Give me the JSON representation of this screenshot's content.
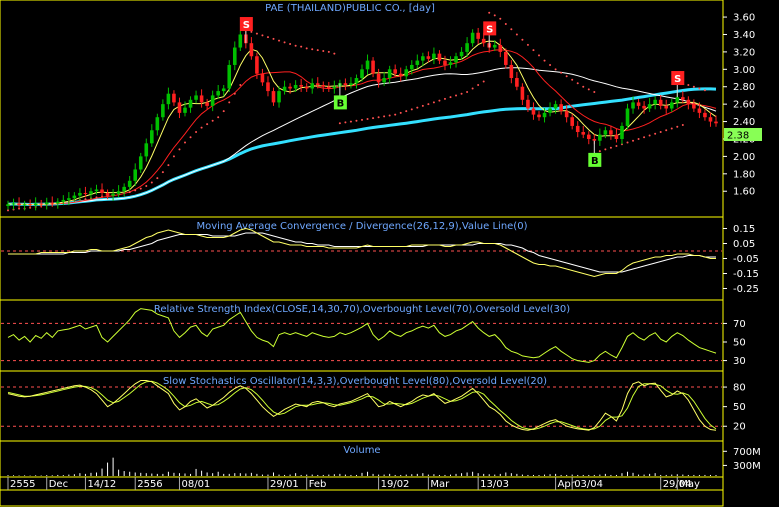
{
  "colors": {
    "background": "#000000",
    "panel_border": "#ffff00",
    "title_text": "#6fa8ff",
    "axis_text": "#ffffff",
    "candle_up": "#00c000",
    "candle_down": "#ff2020",
    "ma_short": "#ffff66",
    "ma_mid": "#ff2020",
    "ma_long": "#ffffff",
    "ma_longest": "#33e0ff",
    "sar": "#ff5050",
    "signal_buy": "#66ff33",
    "signal_sell": "#ff2020",
    "macd_line": "#ffff66",
    "macd_signal": "#ffffff",
    "rsi_line": "#ccff33",
    "ref_level": "#ff5050",
    "stoch_k": "#ffff66",
    "stoch_d": "#ccff33",
    "volume_bar": "#ffffff",
    "last_price_bg": "#88ff55"
  },
  "chart_data": [
    {
      "type": "candlestick",
      "title": "PAE (THAILAND)PUBLIC CO., [day]",
      "ylim": [
        1.35,
        3.75
      ],
      "y_ticks": [
        "3.60",
        "3.40",
        "3.20",
        "3.00",
        "2.80",
        "2.60",
        "2.40",
        "2.20",
        "2.00",
        "1.80",
        "1.60"
      ],
      "last_price": "2.38",
      "closes": [
        1.45,
        1.46,
        1.44,
        1.45,
        1.44,
        1.46,
        1.45,
        1.47,
        1.46,
        1.48,
        1.5,
        1.52,
        1.55,
        1.58,
        1.57,
        1.6,
        1.62,
        1.58,
        1.55,
        1.57,
        1.6,
        1.65,
        1.72,
        1.85,
        2.0,
        2.15,
        2.3,
        2.45,
        2.6,
        2.72,
        2.62,
        2.5,
        2.56,
        2.65,
        2.7,
        2.62,
        2.58,
        2.7,
        2.75,
        2.78,
        3.05,
        3.25,
        3.4,
        3.3,
        3.15,
        2.95,
        2.85,
        2.75,
        2.62,
        2.75,
        2.8,
        2.78,
        2.82,
        2.8,
        2.78,
        2.84,
        2.82,
        2.8,
        2.78,
        2.8,
        2.84,
        2.82,
        2.84,
        2.9,
        3.0,
        3.1,
        2.95,
        2.85,
        2.9,
        3.0,
        2.95,
        2.92,
        3.0,
        3.05,
        3.1,
        3.15,
        3.12,
        3.18,
        3.1,
        3.05,
        3.08,
        3.15,
        3.2,
        3.3,
        3.42,
        3.35,
        3.3,
        3.25,
        3.28,
        3.2,
        3.05,
        2.9,
        2.8,
        2.65,
        2.55,
        2.48,
        2.45,
        2.5,
        2.55,
        2.6,
        2.52,
        2.45,
        2.35,
        2.28,
        2.25,
        2.2,
        2.18,
        2.25,
        2.3,
        2.25,
        2.2,
        2.35,
        2.55,
        2.62,
        2.58,
        2.55,
        2.6,
        2.65,
        2.58,
        2.55,
        2.62,
        2.68,
        2.65,
        2.6,
        2.55,
        2.5,
        2.45,
        2.4,
        2.38
      ],
      "sar": [
        1.38,
        1.39,
        1.4,
        1.4,
        1.41,
        1.42,
        1.43,
        1.44,
        1.45,
        1.46,
        1.47,
        1.48,
        1.49,
        1.5,
        1.51,
        1.52,
        1.53,
        1.54,
        1.55,
        1.56,
        1.57,
        1.58,
        1.59,
        1.61,
        1.63,
        1.66,
        1.7,
        1.75,
        1.82,
        1.9,
        2.0,
        2.08,
        2.16,
        2.22,
        2.28,
        2.33,
        2.37,
        2.41,
        2.45,
        2.52,
        2.62,
        2.72,
        2.82,
        3.45,
        3.43,
        3.41,
        3.39,
        3.37,
        3.35,
        3.33,
        3.31,
        3.29,
        3.27,
        3.26,
        3.24,
        3.23,
        3.22,
        3.21,
        3.2,
        3.18,
        2.38,
        2.39,
        2.4,
        2.41,
        2.42,
        2.43,
        2.44,
        2.45,
        2.46,
        2.47,
        2.48,
        2.5,
        2.52,
        2.54,
        2.56,
        2.58,
        2.6,
        2.62,
        2.64,
        2.66,
        2.68,
        2.7,
        2.72,
        2.74,
        2.78,
        2.82,
        2.86,
        3.65,
        3.62,
        3.58,
        3.52,
        3.46,
        3.4,
        3.34,
        3.28,
        3.22,
        3.16,
        3.1,
        3.05,
        3.0,
        2.96,
        2.92,
        2.88,
        2.84,
        2.8,
        2.77,
        2.74,
        2.06,
        2.08,
        2.1,
        2.12,
        2.14,
        2.16,
        2.18,
        2.2,
        2.22,
        2.24,
        2.26,
        2.28,
        2.3,
        2.32,
        2.34,
        2.36,
        2.82,
        2.8,
        2.78,
        2.76
      ],
      "signals": [
        {
          "index": 43,
          "kind": "S",
          "label": "S"
        },
        {
          "index": 60,
          "kind": "B",
          "label": "B"
        },
        {
          "index": 87,
          "kind": "S",
          "label": "S"
        },
        {
          "index": 106,
          "kind": "B",
          "label": "B"
        },
        {
          "index": 121,
          "kind": "S",
          "label": "S"
        }
      ]
    },
    {
      "type": "line",
      "title": "Moving Average Convergence / Divergence(26,12,9),Value Line(0)",
      "ylim": [
        -0.3,
        0.2
      ],
      "y_ticks": [
        "0.15",
        "0.05",
        "-0.05",
        "-0.15",
        "-0.25"
      ],
      "reference_levels": [
        0
      ],
      "macd": [
        -0.02,
        -0.02,
        -0.02,
        -0.02,
        -0.02,
        -0.02,
        -0.01,
        -0.01,
        -0.01,
        -0.01,
        -0.01,
        -0.01,
        0,
        0,
        0,
        0.01,
        0.01,
        0,
        0,
        0,
        0.01,
        0.02,
        0.03,
        0.05,
        0.07,
        0.09,
        0.1,
        0.12,
        0.13,
        0.14,
        0.13,
        0.12,
        0.11,
        0.11,
        0.11,
        0.1,
        0.09,
        0.09,
        0.09,
        0.09,
        0.1,
        0.12,
        0.14,
        0.15,
        0.14,
        0.12,
        0.1,
        0.08,
        0.06,
        0.06,
        0.05,
        0.04,
        0.04,
        0.04,
        0.03,
        0.03,
        0.03,
        0.03,
        0.02,
        0.02,
        0.02,
        0.02,
        0.02,
        0.02,
        0.03,
        0.04,
        0.03,
        0.03,
        0.03,
        0.03,
        0.03,
        0.03,
        0.03,
        0.04,
        0.04,
        0.04,
        0.04,
        0.04,
        0.04,
        0.03,
        0.03,
        0.04,
        0.04,
        0.05,
        0.06,
        0.06,
        0.05,
        0.05,
        0.05,
        0.04,
        0.02,
        0,
        -0.02,
        -0.04,
        -0.06,
        -0.08,
        -0.09,
        -0.09,
        -0.1,
        -0.1,
        -0.11,
        -0.12,
        -0.13,
        -0.14,
        -0.15,
        -0.16,
        -0.17,
        -0.16,
        -0.15,
        -0.15,
        -0.15,
        -0.13,
        -0.1,
        -0.08,
        -0.07,
        -0.06,
        -0.05,
        -0.04,
        -0.04,
        -0.03,
        -0.03,
        -0.02,
        -0.02,
        -0.02,
        -0.03,
        -0.03,
        -0.04,
        -0.05,
        -0.05
      ],
      "signal": [
        -0.02,
        -0.02,
        -0.02,
        -0.02,
        -0.02,
        -0.02,
        -0.02,
        -0.02,
        -0.02,
        -0.02,
        -0.02,
        -0.01,
        -0.01,
        -0.01,
        -0.01,
        0,
        0,
        0,
        0,
        0,
        0,
        0.01,
        0.01,
        0.02,
        0.03,
        0.04,
        0.05,
        0.07,
        0.08,
        0.09,
        0.1,
        0.11,
        0.11,
        0.11,
        0.11,
        0.11,
        0.11,
        0.1,
        0.1,
        0.1,
        0.1,
        0.1,
        0.11,
        0.12,
        0.12,
        0.12,
        0.12,
        0.11,
        0.1,
        0.09,
        0.08,
        0.07,
        0.06,
        0.06,
        0.05,
        0.05,
        0.04,
        0.04,
        0.04,
        0.03,
        0.03,
        0.03,
        0.03,
        0.03,
        0.03,
        0.03,
        0.03,
        0.03,
        0.03,
        0.03,
        0.03,
        0.03,
        0.03,
        0.03,
        0.03,
        0.03,
        0.04,
        0.04,
        0.04,
        0.04,
        0.04,
        0.04,
        0.04,
        0.04,
        0.04,
        0.05,
        0.05,
        0.05,
        0.05,
        0.05,
        0.04,
        0.04,
        0.03,
        0.02,
        0,
        -0.01,
        -0.03,
        -0.04,
        -0.05,
        -0.06,
        -0.07,
        -0.08,
        -0.09,
        -0.1,
        -0.11,
        -0.12,
        -0.13,
        -0.14,
        -0.14,
        -0.14,
        -0.14,
        -0.14,
        -0.13,
        -0.12,
        -0.11,
        -0.1,
        -0.09,
        -0.08,
        -0.07,
        -0.06,
        -0.05,
        -0.04,
        -0.04,
        -0.03,
        -0.03,
        -0.03,
        -0.04,
        -0.04,
        -0.04
      ]
    },
    {
      "type": "line",
      "title": "Relative Strength Index(CLOSE,14,30,70),Overbought Level(70),Oversold Level(30)",
      "ylim": [
        22,
        92
      ],
      "y_ticks": [
        "70",
        "50",
        "30"
      ],
      "reference_levels": [
        70,
        30
      ],
      "rsi": [
        55,
        58,
        52,
        56,
        50,
        57,
        54,
        60,
        55,
        62,
        63,
        64,
        66,
        68,
        64,
        66,
        68,
        55,
        50,
        56,
        62,
        68,
        74,
        82,
        86,
        85,
        84,
        80,
        78,
        76,
        62,
        55,
        60,
        66,
        68,
        60,
        56,
        64,
        66,
        68,
        74,
        78,
        82,
        72,
        62,
        55,
        52,
        50,
        45,
        58,
        60,
        58,
        60,
        58,
        56,
        60,
        58,
        56,
        55,
        56,
        60,
        58,
        60,
        63,
        66,
        70,
        58,
        52,
        56,
        62,
        58,
        56,
        60,
        62,
        65,
        67,
        65,
        68,
        60,
        56,
        58,
        62,
        64,
        68,
        72,
        65,
        60,
        56,
        58,
        52,
        44,
        40,
        38,
        35,
        34,
        33,
        34,
        38,
        42,
        45,
        40,
        36,
        32,
        30,
        29,
        28,
        30,
        36,
        40,
        36,
        33,
        44,
        56,
        60,
        55,
        52,
        57,
        60,
        53,
        50,
        56,
        60,
        57,
        52,
        48,
        44,
        42,
        40,
        38
      ]
    },
    {
      "type": "line",
      "title": "Slow Stochastics Oscillator(14,3,3),Overbought Level(80),Oversold Level(20)",
      "ylim": [
        2,
        100
      ],
      "y_ticks": [
        "80",
        "50",
        "20"
      ],
      "reference_levels": [
        80,
        20
      ],
      "stoch_k": [
        70,
        68,
        66,
        65,
        66,
        68,
        70,
        72,
        74,
        76,
        78,
        80,
        82,
        83,
        80,
        76,
        70,
        60,
        50,
        55,
        62,
        70,
        78,
        85,
        90,
        90,
        88,
        82,
        76,
        70,
        55,
        45,
        50,
        58,
        62,
        55,
        48,
        52,
        58,
        64,
        72,
        78,
        82,
        78,
        70,
        60,
        50,
        42,
        35,
        40,
        46,
        50,
        54,
        52,
        50,
        56,
        58,
        56,
        52,
        50,
        54,
        56,
        58,
        62,
        66,
        70,
        60,
        50,
        52,
        58,
        54,
        50,
        54,
        58,
        64,
        68,
        66,
        70,
        62,
        55,
        58,
        62,
        66,
        72,
        78,
        70,
        60,
        50,
        45,
        38,
        28,
        22,
        18,
        15,
        14,
        16,
        20,
        24,
        28,
        30,
        25,
        20,
        18,
        16,
        15,
        14,
        18,
        28,
        40,
        35,
        28,
        45,
        70,
        85,
        88,
        82,
        85,
        86,
        75,
        65,
        68,
        74,
        70,
        60,
        45,
        30,
        20,
        15,
        14
      ],
      "stoch_d": [
        72,
        70,
        68,
        66,
        66,
        67,
        68,
        70,
        72,
        74,
        76,
        78,
        80,
        81,
        81,
        79,
        75,
        68,
        60,
        56,
        58,
        64,
        70,
        77,
        84,
        88,
        89,
        86,
        81,
        75,
        66,
        56,
        50,
        52,
        56,
        58,
        55,
        52,
        53,
        58,
        64,
        71,
        77,
        79,
        76,
        69,
        60,
        50,
        42,
        38,
        40,
        45,
        50,
        52,
        52,
        53,
        55,
        56,
        55,
        53,
        52,
        54,
        56,
        59,
        62,
        66,
        65,
        60,
        54,
        54,
        55,
        54,
        53,
        55,
        59,
        63,
        66,
        68,
        66,
        62,
        58,
        59,
        62,
        67,
        72,
        73,
        69,
        60,
        52,
        44,
        37,
        29,
        23,
        18,
        16,
        15,
        17,
        20,
        24,
        27,
        27,
        24,
        21,
        18,
        16,
        15,
        16,
        20,
        29,
        34,
        34,
        36,
        48,
        67,
        81,
        85,
        85,
        84,
        82,
        75,
        70,
        69,
        71,
        68,
        58,
        45,
        32,
        22,
        16
      ]
    },
    {
      "type": "bar",
      "title": "Volume",
      "y_ticks": [
        "700M",
        "300M"
      ],
      "volume_m": [
        25,
        20,
        15,
        18,
        12,
        20,
        15,
        25,
        20,
        30,
        25,
        40,
        50,
        80,
        60,
        90,
        100,
        210,
        380,
        520,
        180,
        140,
        120,
        100,
        90,
        80,
        70,
        60,
        60,
        120,
        90,
        80,
        70,
        60,
        200,
        150,
        100,
        80,
        120,
        60,
        60,
        80,
        80,
        70,
        90,
        60,
        40,
        40,
        100,
        40,
        30,
        40,
        80,
        30,
        40,
        40,
        30,
        30,
        40,
        50,
        60,
        40,
        30,
        30,
        90,
        120,
        60,
        40,
        40,
        60,
        30,
        30,
        40,
        50,
        60,
        80,
        40,
        50,
        30,
        30,
        40,
        60,
        80,
        100,
        120,
        80,
        60,
        50,
        40,
        60,
        100,
        80,
        60,
        40,
        30,
        30,
        30,
        40,
        50,
        60,
        30,
        30,
        40,
        30,
        30,
        30,
        30,
        40,
        60,
        30,
        30,
        80,
        120,
        90,
        40,
        40,
        60,
        80,
        30,
        30,
        40,
        50,
        40,
        30,
        30,
        30,
        30,
        30,
        30
      ]
    }
  ],
  "x_axis": {
    "labels": [
      {
        "text": "2555",
        "index": 0
      },
      {
        "text": "Dec",
        "index": 7
      },
      {
        "text": "14/12",
        "index": 14
      },
      {
        "text": "2556",
        "index": 23
      },
      {
        "text": "08/01",
        "index": 31
      },
      {
        "text": "29/01",
        "index": 47
      },
      {
        "text": "Feb",
        "index": 54
      },
      {
        "text": "19/02",
        "index": 67
      },
      {
        "text": "Mar",
        "index": 76
      },
      {
        "text": "13/03",
        "index": 85
      },
      {
        "text": "Apr",
        "index": 99
      },
      {
        "text": "03/04",
        "index": 102
      },
      {
        "text": "29/04",
        "index": 118
      },
      {
        "text": "May",
        "index": 121
      }
    ]
  }
}
